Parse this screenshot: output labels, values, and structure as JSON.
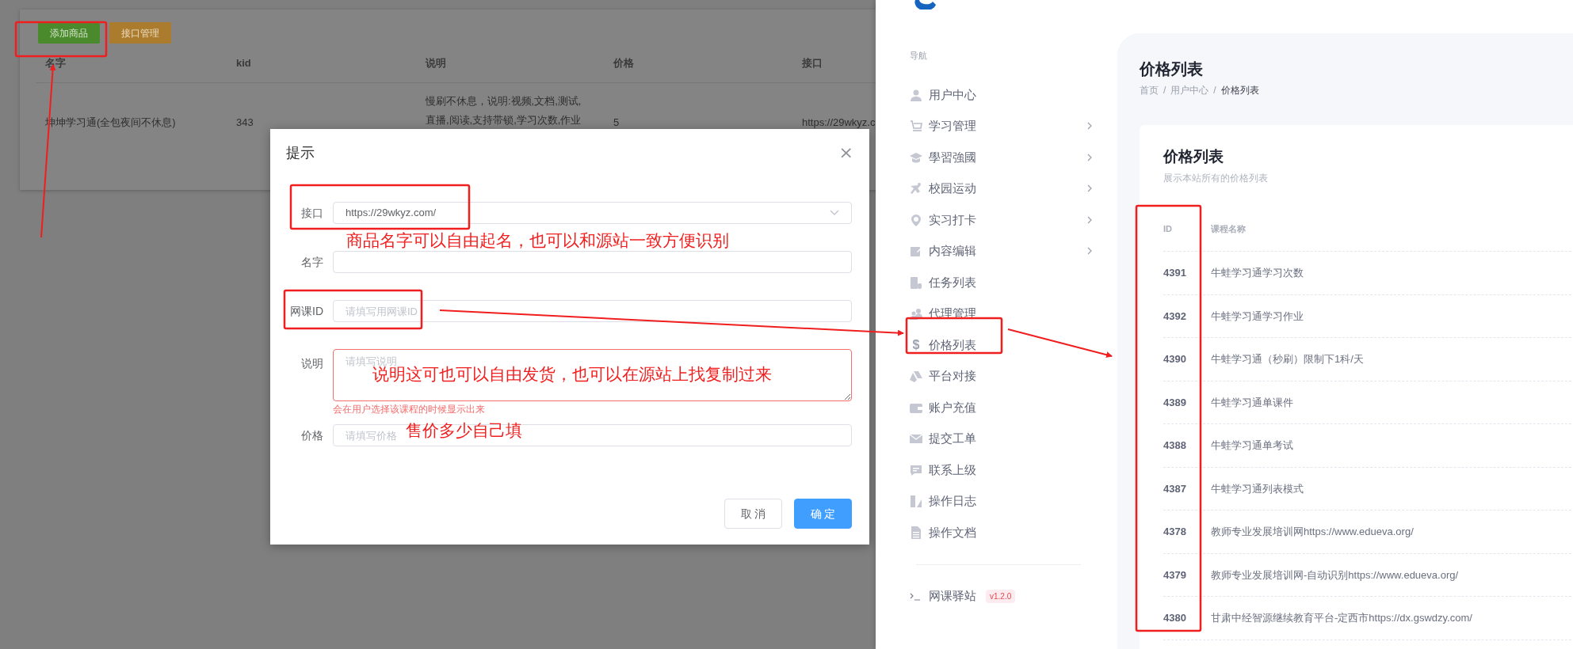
{
  "background_page": {
    "buttons": [
      {
        "label": "添加商品",
        "kind": "success"
      },
      {
        "label": "接口管理",
        "kind": "warning"
      }
    ],
    "table": {
      "columns": [
        "名字",
        "kid",
        "说明",
        "价格",
        "接口"
      ],
      "rows": [
        {
          "cells": [
            "坤坤学习通(全包夜间不休息)",
            "343",
            "慢刷不休息，说明:视频,文档,测试,\n直播,阅读,支持带锁,学习次数,作业",
            "5",
            "https://29wkyz.c"
          ]
        }
      ]
    }
  },
  "dialog": {
    "title": "提示",
    "close": "×",
    "fields": [
      {
        "kind": "select",
        "label": "接口",
        "value": "https://29wkyz.com/"
      },
      {
        "kind": "input",
        "label": "名字"
      },
      {
        "kind": "input",
        "label": "网课ID",
        "placeholder": "请填写用网课ID"
      },
      {
        "kind": "textarea",
        "label": "说明",
        "placeholder": "请填写说明",
        "error": true,
        "help": "会在用户选择该课程的时候显示出来"
      },
      {
        "kind": "input",
        "label": "价格",
        "placeholder": "请填写价格"
      }
    ],
    "buttons": [
      {
        "label": "取 消",
        "kind": "default"
      },
      {
        "label": "确 定",
        "kind": "primary"
      }
    ]
  },
  "sidebar": {
    "section": "导航",
    "items": [
      {
        "label": "用户中心",
        "submenu": false
      },
      {
        "label": "学习管理",
        "submenu": true
      },
      {
        "label": "學習強國",
        "submenu": true
      },
      {
        "label": "校园运动",
        "submenu": true
      },
      {
        "label": "实习打卡",
        "submenu": true
      },
      {
        "label": "内容编辑",
        "submenu": true
      },
      {
        "label": "任务列表",
        "submenu": false
      },
      {
        "label": "代理管理",
        "submenu": false
      },
      {
        "label": "价格列表",
        "glyph": "$",
        "submenu": false
      },
      {
        "label": "平台对接",
        "submenu": false
      },
      {
        "label": "账户充值",
        "submenu": false
      },
      {
        "label": "提交工单",
        "submenu": false
      },
      {
        "label": "联系上级",
        "submenu": false
      },
      {
        "label": "操作日志",
        "submenu": false
      },
      {
        "label": "操作文档",
        "submenu": false
      }
    ],
    "footer": {
      "label": "网课驿站",
      "version": "v1.2.0"
    }
  },
  "main": {
    "title": "价格列表",
    "breadcrumb": [
      {
        "kind": "link",
        "text": "首页"
      },
      {
        "kind": "separator",
        "text": "/"
      },
      {
        "kind": "link",
        "text": "用户中心"
      },
      {
        "kind": "separator",
        "text": "/"
      },
      {
        "kind": "current",
        "text": "价格列表"
      }
    ],
    "card": {
      "title": "价格列表",
      "subtitle": "展示本站所有的价格列表",
      "columns": [
        "ID",
        "课程名称"
      ],
      "rows": [
        [
          "4391",
          "牛蛙学习通学习次数"
        ],
        [
          "4392",
          "牛蛙学习通学习作业"
        ],
        [
          "4390",
          "牛蛙学习通（秒刷）限制下1科/天"
        ],
        [
          "4389",
          "牛蛙学习通单课件"
        ],
        [
          "4388",
          "牛蛙学习通单考试"
        ],
        [
          "4387",
          "牛蛙学习通列表模式"
        ],
        [
          "4378",
          "教师专业发展培训网https://www.edueva.org/"
        ],
        [
          "4379",
          "教师专业发展培训网-自动识别https://www.edueva.org/"
        ],
        [
          "4380",
          "甘肃中经智源继续教育平台-定西市https://dx.gswdzy.com/"
        ]
      ]
    }
  },
  "annotations": [
    "商品名字可以自由起名，也可以和源站一致方便识别",
    "说明这可也可以自由发货，也可以在源站上找复制过来",
    "售价多少自己填"
  ]
}
